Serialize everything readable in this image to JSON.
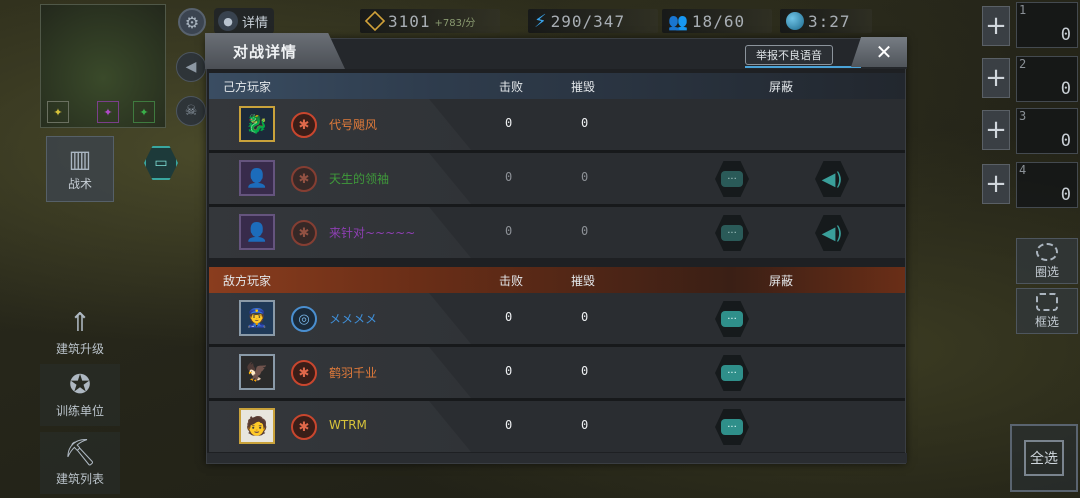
{
  "hud": {
    "detail_label": "详情",
    "gold": "3101",
    "gold_rate": "+783/分",
    "energy": "290/347",
    "population": "18/60",
    "time": "3:27"
  },
  "left_panel": {
    "tactics_label": "战术",
    "building_upgrade_label": "建筑升级",
    "train_units_label": "训练单位",
    "building_list_label": "建筑列表"
  },
  "right_panel": {
    "slots": [
      {
        "index": "1",
        "count": "0"
      },
      {
        "index": "2",
        "count": "0"
      },
      {
        "index": "3",
        "count": "0"
      },
      {
        "index": "4",
        "count": "0"
      }
    ],
    "lasso_select_label": "圈选",
    "box_select_label": "框选",
    "select_all_label": "全选"
  },
  "dialog": {
    "title": "对战详情",
    "report_button": "举报不良语音",
    "close_symbol": "✕",
    "columns": {
      "kills": "击败",
      "destroyed": "摧毁",
      "mute": "屏蔽"
    },
    "friendly": {
      "label": "己方玩家",
      "players": [
        {
          "name": "代号飓风",
          "kills": "0",
          "destroyed": "0",
          "name_color": "#e07a3a"
        },
        {
          "name": "天生的领袖",
          "kills": "0",
          "destroyed": "0",
          "name_color": "#3f9a3a"
        },
        {
          "name": "来针对~~~~~",
          "kills": "0",
          "destroyed": "0",
          "name_color": "#8e3fb3"
        }
      ]
    },
    "enemy": {
      "label": "敌方玩家",
      "players": [
        {
          "name": "メメメメ",
          "kills": "0",
          "destroyed": "0",
          "name_color": "#3f8fd8"
        },
        {
          "name": "鹤羽千业",
          "kills": "0",
          "destroyed": "0",
          "name_color": "#e07a3a"
        },
        {
          "name": "WTRM",
          "kills": "0",
          "destroyed": "0",
          "name_color": "#d6c23a"
        }
      ]
    }
  },
  "icons": {
    "gear": "gear-icon",
    "gold": "gold-crate-icon",
    "energy": "lightning-icon",
    "population": "population-icon",
    "time": "globe-icon",
    "chat": "chat-icon",
    "voice": "speaker-icon",
    "rank": "rank-badge-icon"
  }
}
